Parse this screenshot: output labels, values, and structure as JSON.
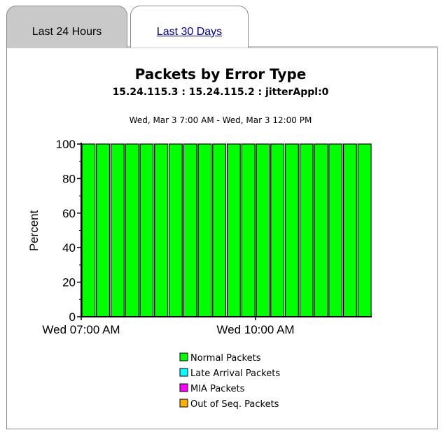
{
  "tabs": [
    {
      "label": "Last 24 Hours",
      "active": true
    },
    {
      "label": "Last 30 Days",
      "active": false
    }
  ],
  "chart_data": {
    "type": "bar",
    "stacked": true,
    "title": "Packets by Error Type",
    "subtitle": "15.24.115.3 : 15.24.115.2 : jitterAppl:0",
    "date_range": "Wed, Mar 3 7:00 AM - Wed, Mar 3 12:00 PM",
    "ylabel": "Percent",
    "xlabel": "",
    "ylim": [
      0,
      100
    ],
    "yticks": [
      "0",
      "20",
      "40",
      "60",
      "80",
      "100"
    ],
    "xtick_labels": [
      "Wed 07:00 AM",
      "Wed 10:00 AM"
    ],
    "bar_count": 20,
    "series": [
      {
        "name": "Normal Packets",
        "color": "#00ff00",
        "values": [
          100,
          100,
          100,
          100,
          100,
          100,
          100,
          100,
          100,
          100,
          100,
          100,
          100,
          100,
          100,
          100,
          100,
          100,
          100,
          100
        ]
      },
      {
        "name": "Late Arrival Packets",
        "color": "#00ffff",
        "values": [
          0,
          0,
          0,
          0,
          0,
          0,
          0,
          0,
          0,
          0,
          0,
          0,
          0,
          0,
          0,
          0,
          0,
          0,
          0,
          0
        ]
      },
      {
        "name": "MIA Packets",
        "color": "#ff00ff",
        "values": [
          0,
          0,
          0,
          0,
          0,
          0,
          0,
          0,
          0,
          0,
          0,
          0,
          0,
          0,
          0,
          0,
          0,
          0,
          0,
          0
        ]
      },
      {
        "name": "Out of Seq. Packets",
        "color": "#ffb000",
        "values": [
          0,
          0,
          0,
          0,
          0,
          0,
          0,
          0,
          0,
          0,
          0,
          0,
          0,
          0,
          0,
          0,
          0,
          0,
          0,
          0
        ]
      }
    ],
    "grid": false,
    "legend_position": "bottom"
  }
}
